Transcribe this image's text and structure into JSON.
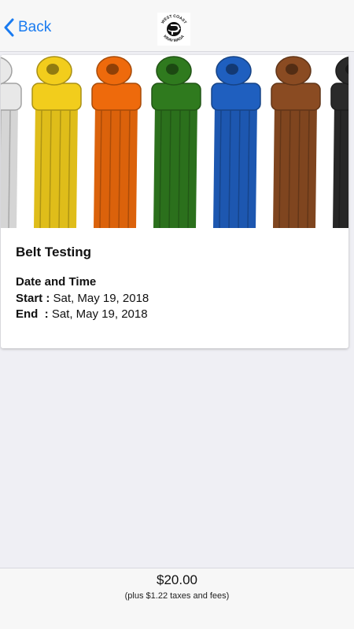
{
  "nav": {
    "back_label": "Back",
    "back_icon": "chevron-left-icon",
    "logo_icon": "krav-maga-logo"
  },
  "logo": {
    "top_text": "WEST COAST",
    "bottom_text": "KRAV MAGA"
  },
  "event": {
    "image": "belt-colors-photo",
    "belt_colors": [
      "#e8e8e8",
      "#f2cd1c",
      "#ee6a0c",
      "#2f7a1e",
      "#1f5fbf",
      "#8a4b22",
      "#2a2a2a"
    ],
    "title": "Belt Testing",
    "date_time_heading": "Date and Time",
    "start_label": "Start : ",
    "start_value": "Sat, May 19, 2018",
    "end_label": "End  : ",
    "end_value": "Sat, May 19, 2018"
  },
  "footer": {
    "price": "$20.00",
    "fees_note": "(plus $1.22 taxes and fees)"
  }
}
